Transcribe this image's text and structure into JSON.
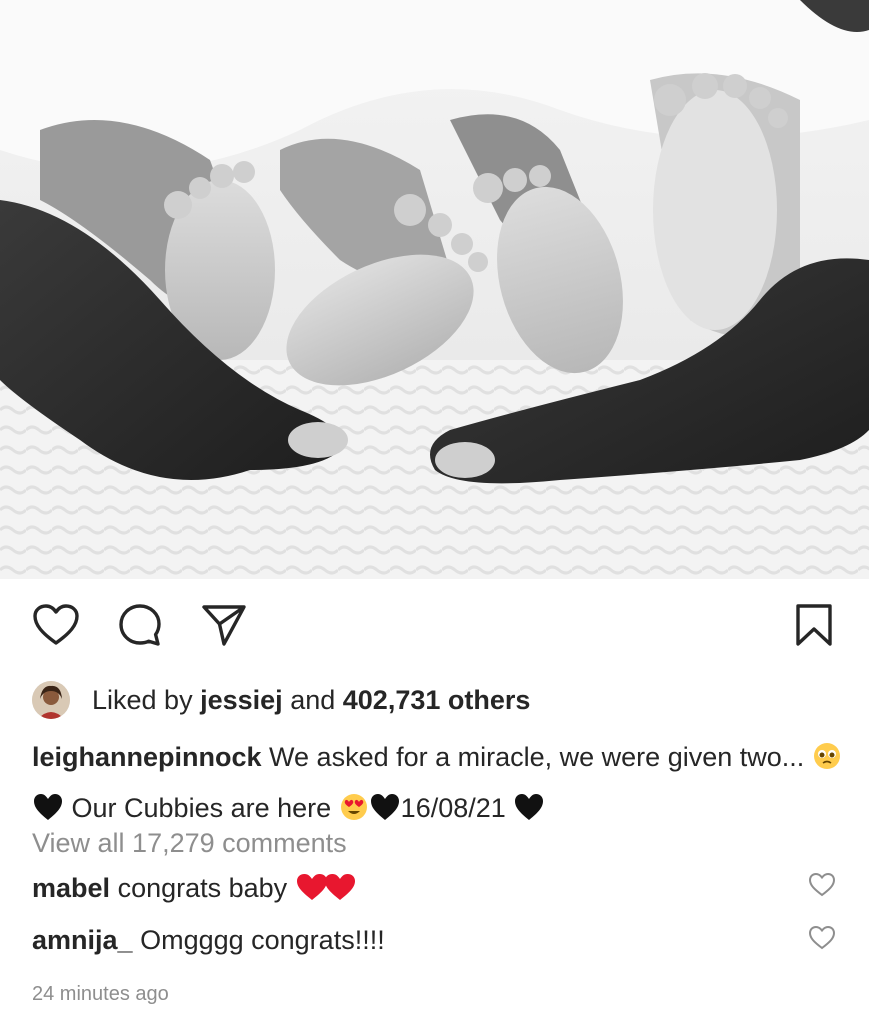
{
  "post": {
    "image": {
      "icon": "baby-feet-photo",
      "palette": [
        "#ffffff",
        "#f0f0f0",
        "#2a2a2a"
      ]
    },
    "actions": {
      "like_icon": "heart-icon",
      "comment_icon": "comment-icon",
      "share_icon": "send-icon",
      "save_icon": "bookmark-icon"
    },
    "likes": {
      "prefix": "Liked by",
      "user": "jessiej",
      "connector": "and",
      "count_text": "402,731 others"
    },
    "caption": {
      "username": "leighannepinnock",
      "text_1": "We asked for a miracle, we were given two...",
      "text_2": "Our Cubbies are here",
      "text_3": "16/08/21",
      "emojis": [
        "pleading-face",
        "black-heart",
        "heart-eyes",
        "black-heart",
        "black-heart"
      ]
    },
    "view_all_comments": "View all 17,279 comments",
    "comments": [
      {
        "username": "mabel",
        "text": "congrats baby",
        "emojis": [
          "red-heart",
          "red-heart"
        ]
      },
      {
        "username": "amnija_",
        "text": "Omgggg congrats!!!!"
      }
    ],
    "timestamp": "24 minutes ago",
    "colors": {
      "text": "#262626",
      "muted": "#8e8e8e",
      "heart": "#e8172f"
    }
  }
}
